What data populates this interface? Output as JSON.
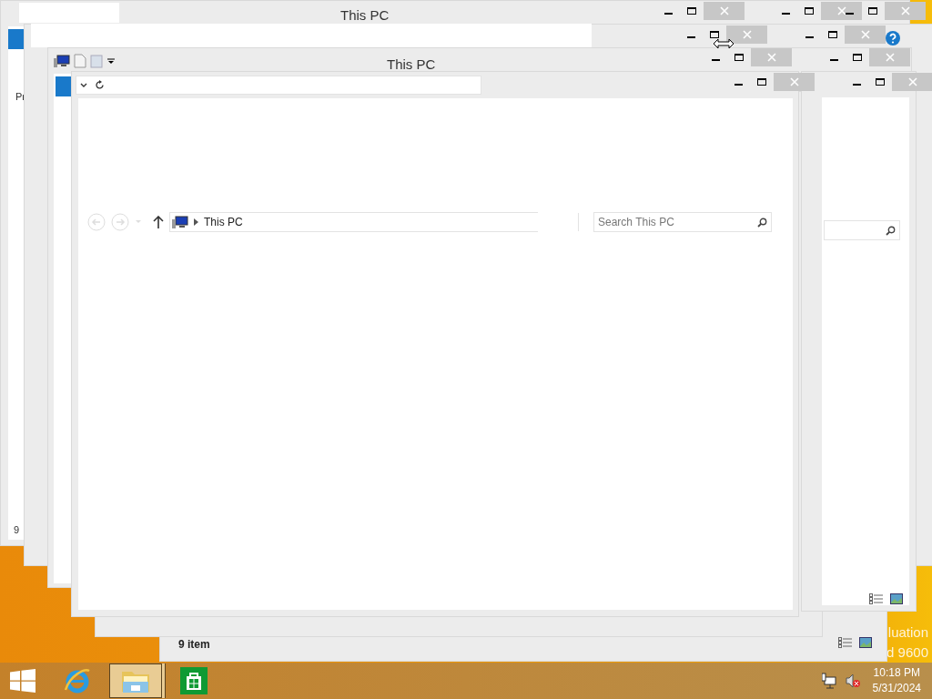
{
  "back_window": {
    "title": "This PC",
    "ribbon_tab": "Pr",
    "status": "9"
  },
  "middle_window": {
    "title": "This PC"
  },
  "front_window": {
    "breadcrumb": "This PC",
    "search": {
      "placeholder": "Search This PC"
    }
  },
  "lower_window": {
    "status": "9 item"
  },
  "desktop": {
    "watermark_lines": [
      "luation",
      "d 9600"
    ]
  },
  "taskbar": {
    "apps": [
      {
        "kind": "ie",
        "selected": false
      },
      {
        "kind": "explorer",
        "selected": true
      },
      {
        "kind": "store",
        "selected": false
      }
    ],
    "clock": {
      "time": "10:18 PM",
      "date": "5/31/2024"
    }
  }
}
